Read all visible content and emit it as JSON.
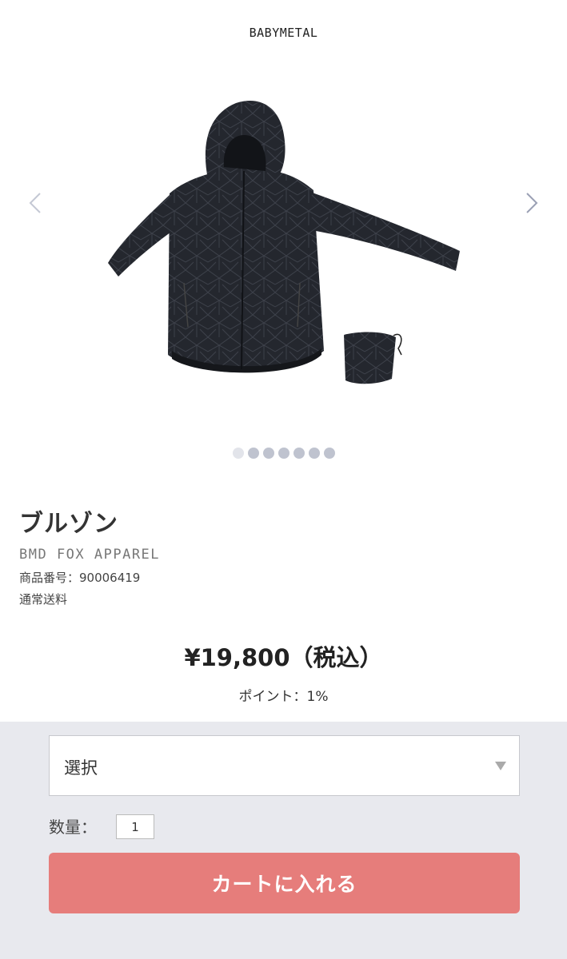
{
  "header": {
    "brand": "BABYMETAL"
  },
  "carousel": {
    "prev_icon": "chevron-left-icon",
    "next_icon": "chevron-right-icon",
    "image": "jacket-with-pouch",
    "dot_count": 7,
    "active_index": 0
  },
  "product": {
    "title": "ブルゾン",
    "maker": "BMD FOX APPAREL",
    "code": "商品番号：90006419",
    "shipping": "通常送料",
    "price": "¥19,800（税込）",
    "points": "ポイント：1%"
  },
  "cart": {
    "select_label": "選択",
    "quantity_label": "数量：",
    "quantity_value": "1",
    "button_label": "カートに入れる"
  },
  "colors": {
    "accent": "#e67d7b",
    "panel_bg": "#e8e9ee",
    "dot": "#bfc3cf"
  }
}
